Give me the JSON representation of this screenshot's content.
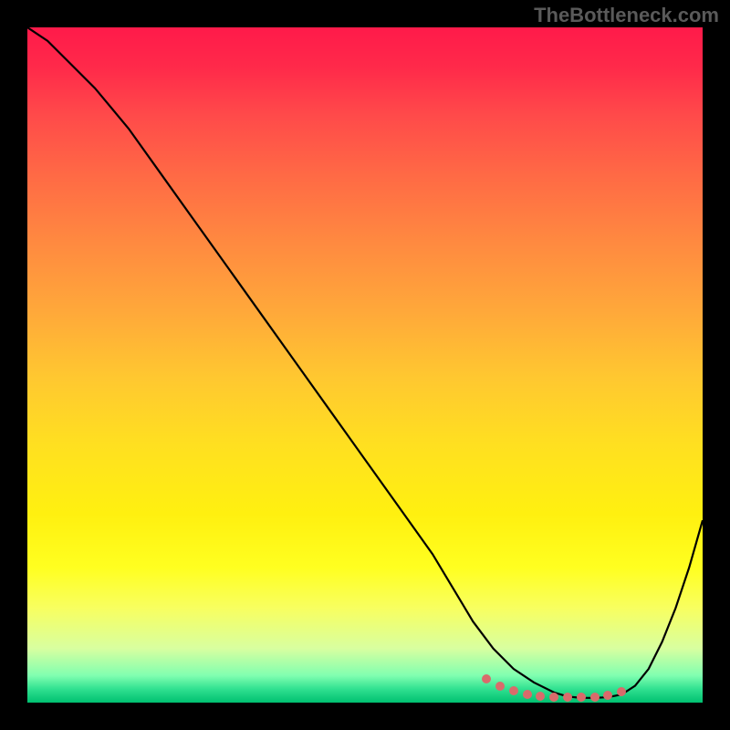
{
  "watermark": "TheBottleneck.com",
  "chart_data": {
    "type": "line",
    "title": "",
    "xlabel": "",
    "ylabel": "",
    "xlim": [
      0,
      100
    ],
    "ylim": [
      0,
      100
    ],
    "grid": false,
    "series": [
      {
        "name": "curve",
        "x": [
          0,
          3,
          6,
          10,
          15,
          20,
          25,
          30,
          35,
          40,
          45,
          50,
          55,
          60,
          63,
          66,
          69,
          72,
          75,
          78,
          80,
          82,
          84,
          86,
          88,
          90,
          92,
          94,
          96,
          98,
          100
        ],
        "values": [
          100,
          98,
          95,
          91,
          85,
          78,
          71,
          64,
          57,
          50,
          43,
          36,
          29,
          22,
          17,
          12,
          8,
          5,
          3,
          1.5,
          0.9,
          0.7,
          0.7,
          0.8,
          1.2,
          2.5,
          5,
          9,
          14,
          20,
          27
        ]
      }
    ],
    "highlight_points": {
      "name": "min-region",
      "color": "#d96b6b",
      "x": [
        68,
        70,
        72,
        74,
        76,
        78,
        80,
        82,
        84,
        86,
        88
      ],
      "values": [
        3.5,
        2.5,
        1.7,
        1.2,
        0.95,
        0.82,
        0.78,
        0.78,
        0.85,
        1.05,
        1.6
      ]
    }
  }
}
